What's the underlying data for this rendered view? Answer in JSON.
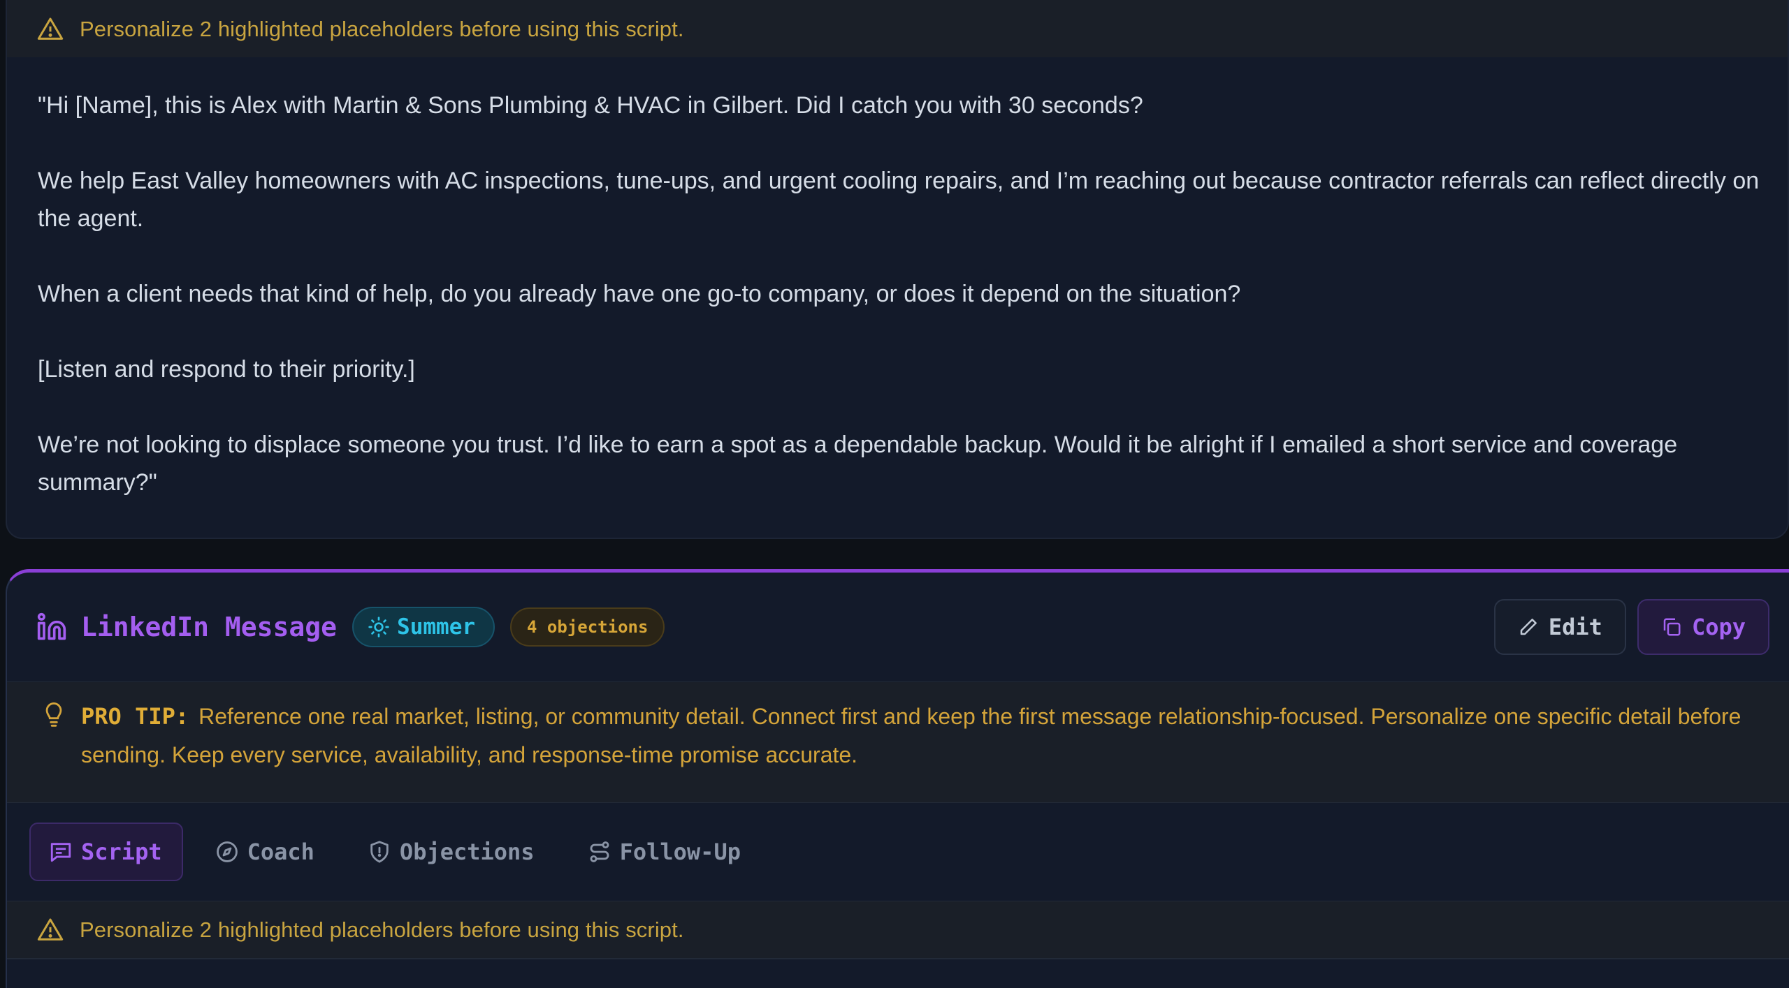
{
  "top_card": {
    "warning": "Personalize 2 highlighted placeholders before using this script.",
    "script_paragraphs": [
      "\"Hi [Name], this is Alex with Martin & Sons Plumbing & HVAC in Gilbert. Did I catch you with 30 seconds?",
      "We help East Valley homeowners with AC inspections, tune-ups, and urgent cooling repairs, and I’m reaching out because contractor referrals can reflect directly on the agent.",
      "When a client needs that kind of help, do you already have one go-to company, or does it depend on the situation?",
      "[Listen and respond to their priority.]",
      "We’re not looking to displace someone you trust. I’d like to earn a spot as a dependable backup. Would it be alright if I emailed a short service and coverage summary?\""
    ]
  },
  "linkedin_card": {
    "title": "LinkedIn Message",
    "season_badge": "Summer",
    "objections_badge": "4 objections",
    "edit_label": "Edit",
    "copy_label": "Copy",
    "pro_tip_label": "PRO TIP:",
    "pro_tip_text": "Reference one real market, listing, or community detail. Connect first and keep the first message relationship-focused. Personalize one specific detail before sending. Keep every service, availability, and response-time promise accurate.",
    "tabs": [
      {
        "label": "Script",
        "icon": "message-icon",
        "active": true
      },
      {
        "label": "Coach",
        "icon": "compass-icon",
        "active": false
      },
      {
        "label": "Objections",
        "icon": "shield-icon",
        "active": false
      },
      {
        "label": "Follow-Up",
        "icon": "route-icon",
        "active": false
      }
    ],
    "warning": "Personalize 2 highlighted placeholders before using this script."
  },
  "colors": {
    "accent_purple": "#a463f2",
    "season_cyan": "#2ec4e8",
    "warning_amber": "#c9a540",
    "background": "#0d1117",
    "card": "#131a2a"
  }
}
